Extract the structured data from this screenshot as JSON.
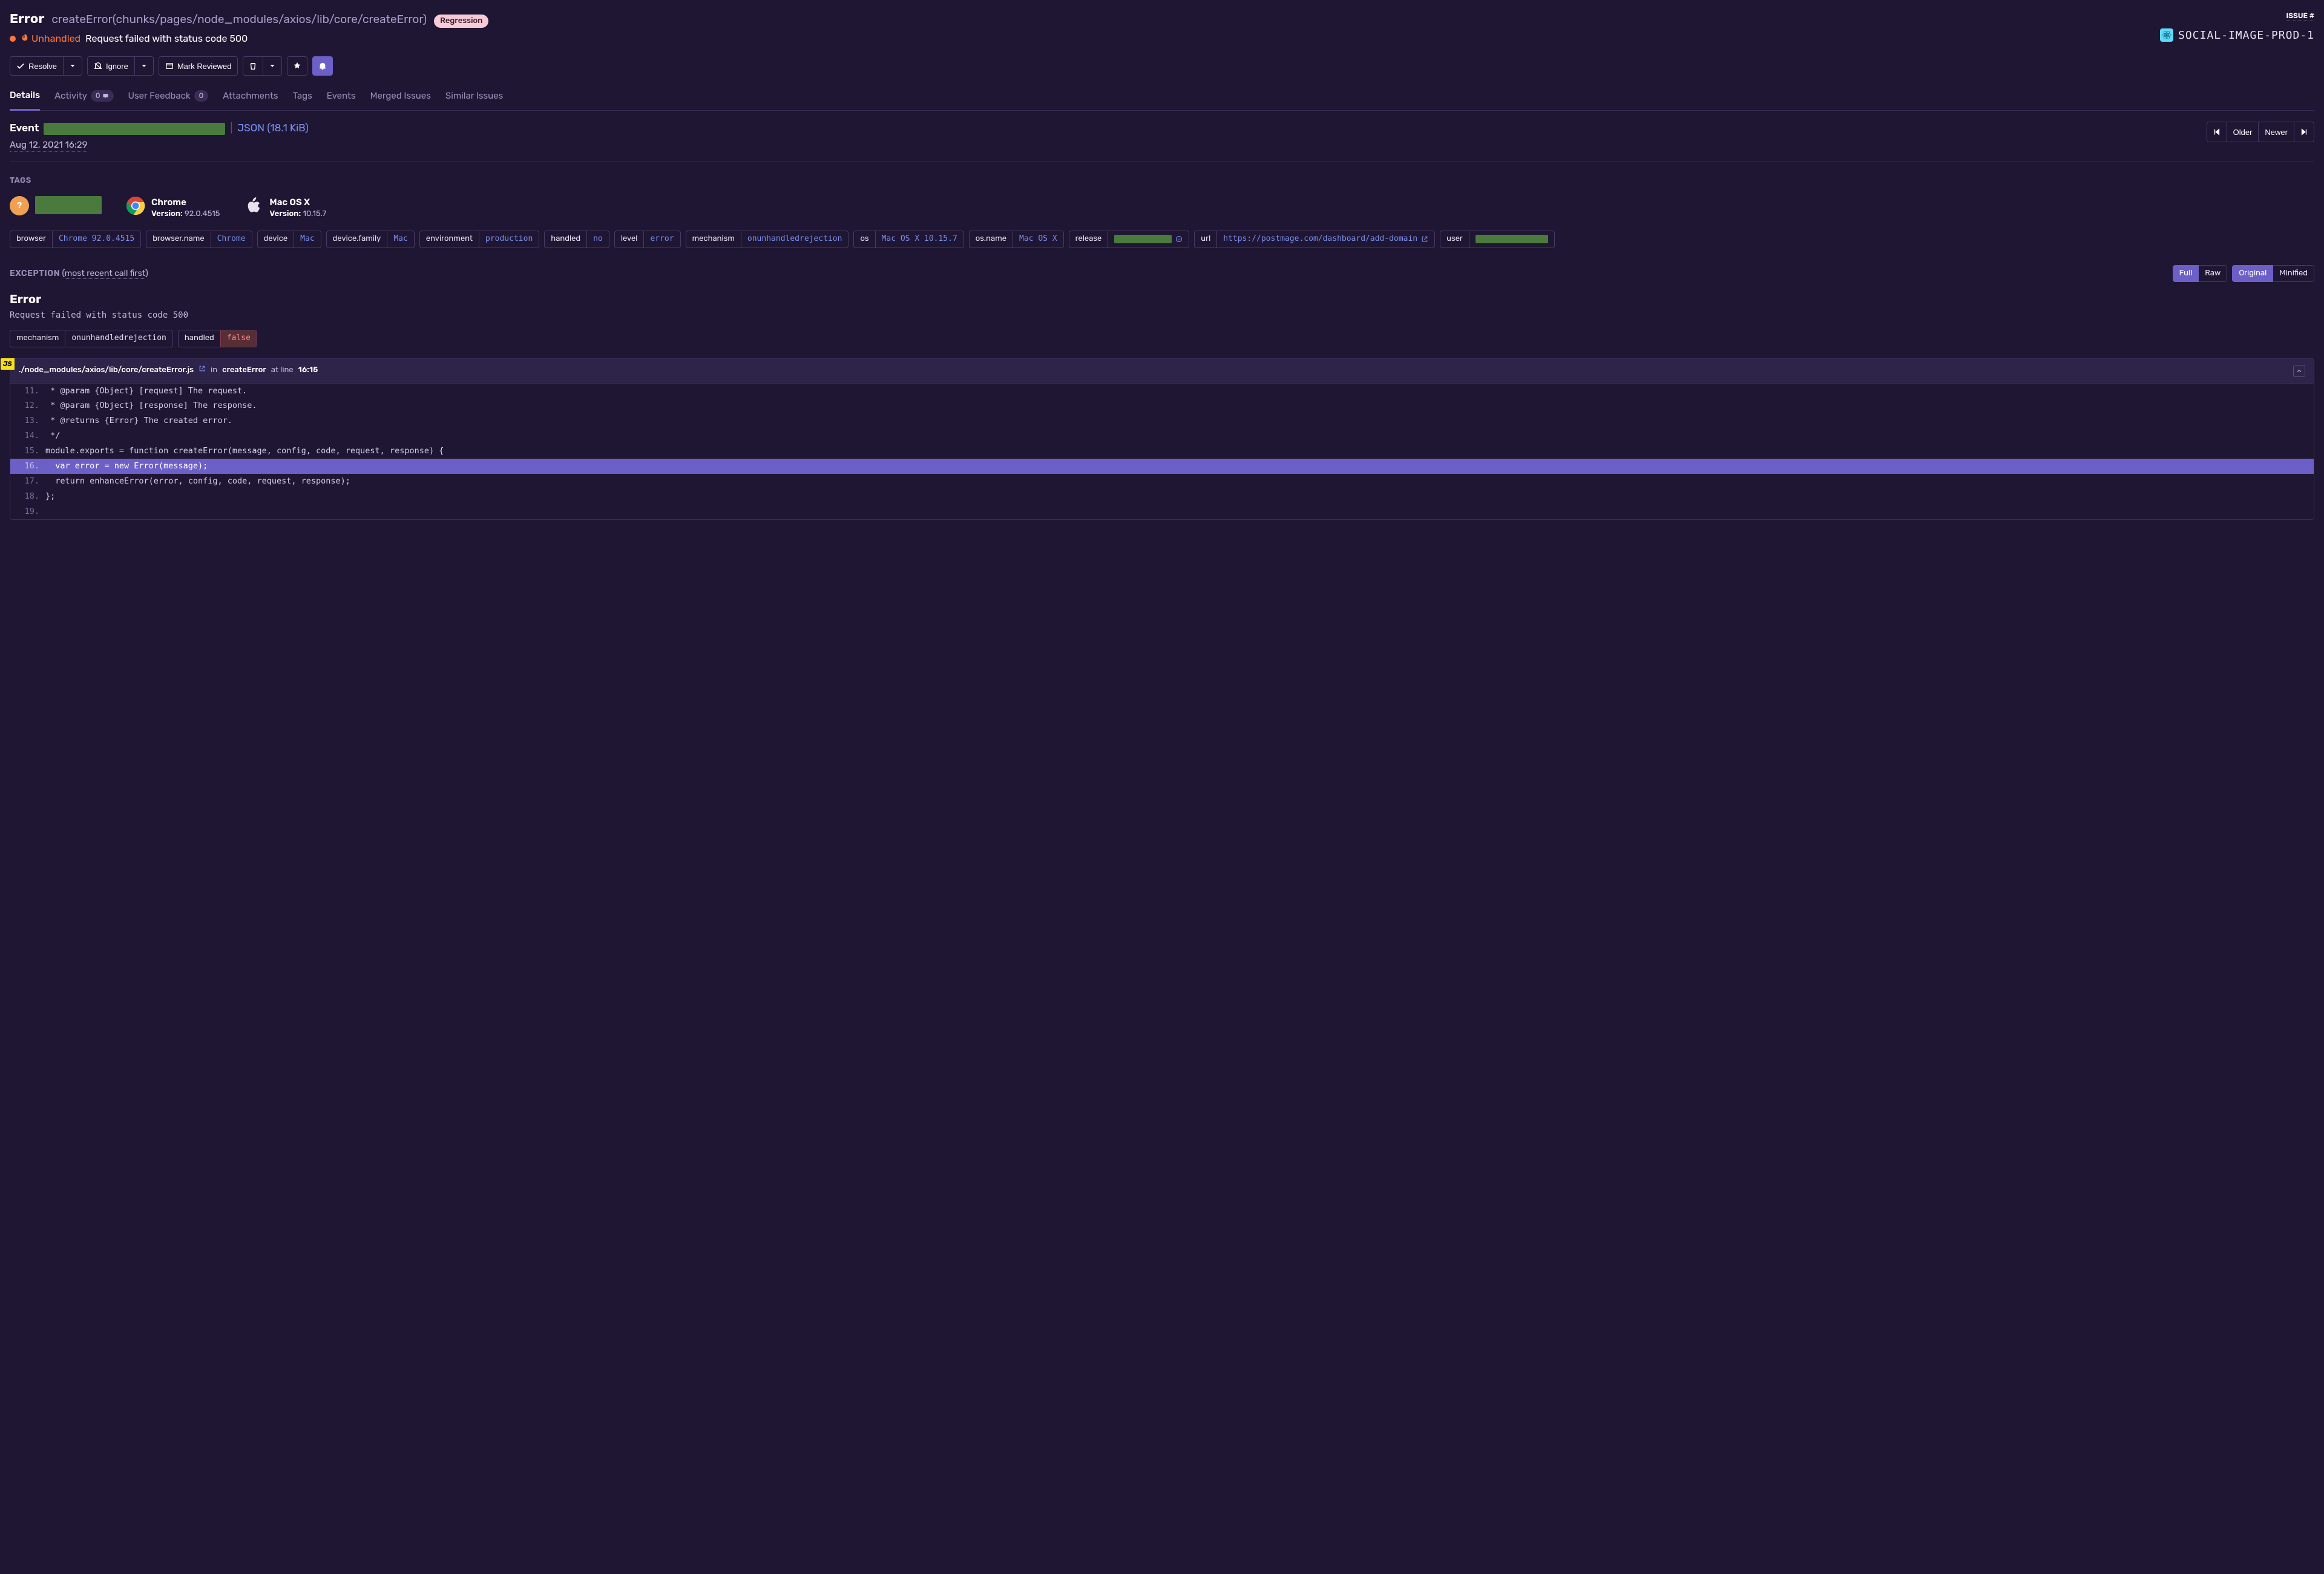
{
  "header": {
    "title": "Error",
    "location": "createError(chunks/pages/node_modules/axios/lib/core/createError)",
    "badge": "Regression",
    "unhandled_label": "Unhandled",
    "message": "Request failed with status code 500",
    "issue_link": "ISSUE #",
    "project": "SOCIAL-IMAGE-PROD-1"
  },
  "actions": {
    "resolve": "Resolve",
    "ignore": "Ignore",
    "mark_reviewed": "Mark Reviewed"
  },
  "tabs": {
    "details": "Details",
    "activity": "Activity",
    "activity_count": "0",
    "user_feedback": "User Feedback",
    "user_feedback_count": "0",
    "attachments": "Attachments",
    "tags": "Tags",
    "events": "Events",
    "merged": "Merged Issues",
    "similar": "Similar Issues"
  },
  "event": {
    "label": "Event",
    "json_label": "JSON (18.1 KiB)",
    "timestamp": "Aug 12, 2021 16:29",
    "older": "Older",
    "newer": "Newer"
  },
  "tags_section": {
    "title": "TAGS",
    "avatar_initial": "?",
    "browser": {
      "name": "Chrome",
      "version_label": "Version:",
      "version": "92.0.4515"
    },
    "os": {
      "name": "Mac OS X",
      "version_label": "Version:",
      "version": "10.15.7"
    },
    "pills": {
      "browser_k": "browser",
      "browser_v": "Chrome 92.0.4515",
      "browser_name_k": "browser.name",
      "browser_name_v": "Chrome",
      "device_k": "device",
      "device_v": "Mac",
      "device_family_k": "device.family",
      "device_family_v": "Mac",
      "environment_k": "environment",
      "environment_v": "production",
      "handled_k": "handled",
      "handled_v": "no",
      "level_k": "level",
      "level_v": "error",
      "mechanism_k": "mechanism",
      "mechanism_v": "onunhandledrejection",
      "os_k": "os",
      "os_v": "Mac OS X 10.15.7",
      "os_name_k": "os.name",
      "os_name_v": "Mac OS X",
      "release_k": "release",
      "url_k": "url",
      "url_v": "https://postmage.com/dashboard/add-domain",
      "user_k": "user"
    }
  },
  "exception": {
    "section_label": "EXCEPTION",
    "note_prefix": "(",
    "note": "most recent call first",
    "note_suffix": ")",
    "view_full": "Full",
    "view_raw": "Raw",
    "view_original": "Original",
    "view_minified": "Minified",
    "name": "Error",
    "message": "Request failed with status code 500",
    "tags": {
      "mechanism_k": "mechanism",
      "mechanism_v": "onunhandledrejection",
      "handled_k": "handled",
      "handled_v": "false"
    }
  },
  "frame": {
    "js_badge": "JS",
    "path": "./node_modules/axios/lib/core/createError.js",
    "in_label": "in",
    "fn": "createError",
    "at_label": "at line",
    "line": "16:15",
    "code": [
      {
        "n": "11.",
        "s": " * @param {Object} [request] The request."
      },
      {
        "n": "12.",
        "s": " * @param {Object} [response] The response."
      },
      {
        "n": "13.",
        "s": " * @returns {Error} The created error."
      },
      {
        "n": "14.",
        "s": " */"
      },
      {
        "n": "15.",
        "s": "module.exports = function createError(message, config, code, request, response) {"
      },
      {
        "n": "16.",
        "s": "  var error = new Error(message);",
        "hi": true
      },
      {
        "n": "17.",
        "s": "  return enhanceError(error, config, code, request, response);"
      },
      {
        "n": "18.",
        "s": "};"
      },
      {
        "n": "19.",
        "s": ""
      }
    ]
  }
}
